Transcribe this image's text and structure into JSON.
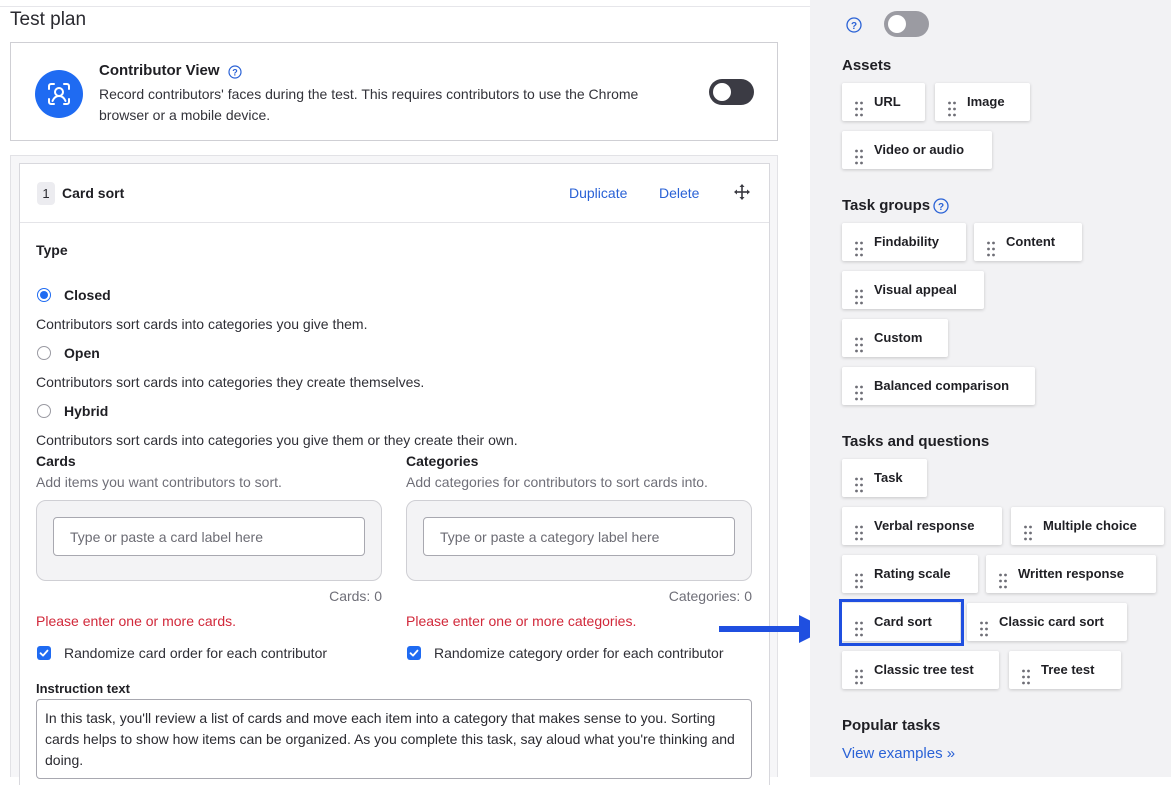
{
  "page": {
    "title": "Test plan"
  },
  "contributor_view": {
    "title": "Contributor View",
    "description": "Record contributors' faces during the test. This requires contributors to use the Chrome browser or a mobile device."
  },
  "task": {
    "number": "1",
    "name": "Card sort",
    "duplicate_label": "Duplicate",
    "delete_label": "Delete",
    "type_label": "Type",
    "options": [
      {
        "label": "Closed",
        "description": "Contributors sort cards into categories you give them."
      },
      {
        "label": "Open",
        "description": "Contributors sort cards into categories they create themselves."
      },
      {
        "label": "Hybrid",
        "description": "Contributors sort cards into categories you give them or they create their own."
      }
    ],
    "cards": {
      "label": "Cards",
      "hint": "Add items you want contributors to sort.",
      "placeholder": "Type or paste a card label here",
      "count": "Cards: 0",
      "error": "Please enter one or more cards.",
      "randomize": "Randomize card order for each contributor"
    },
    "categories": {
      "label": "Categories",
      "hint": "Add categories for contributors to sort cards into.",
      "placeholder": "Type or paste a category label here",
      "count": "Categories: 0",
      "error": "Please enter one or more categories.",
      "randomize": "Randomize category order for each contributor"
    },
    "instruction": {
      "label": "Instruction text",
      "value": "In this task, you'll review a list of cards and move each item into a category that makes sense to you. Sorting cards helps to show how items can be organized. As you complete this task, say aloud what you're thinking and doing."
    }
  },
  "sidebar": {
    "assets": {
      "title": "Assets",
      "items": [
        "URL",
        "Image",
        "Video or audio"
      ]
    },
    "task_groups": {
      "title": "Task groups",
      "items": [
        "Findability",
        "Content",
        "Visual appeal",
        "Custom",
        "Balanced comparison"
      ]
    },
    "tasks_questions": {
      "title": "Tasks and questions",
      "items": [
        "Task",
        "Verbal response",
        "Multiple choice",
        "Rating scale",
        "Written response",
        "Card sort",
        "Classic card sort",
        "Classic tree test",
        "Tree test"
      ]
    },
    "popular": {
      "title": "Popular tasks",
      "link": "View examples »"
    }
  },
  "colors": {
    "accent": "#1f6bf2",
    "link": "#2a62d6",
    "error": "#d1283a",
    "highlight": "#1f4fe0"
  }
}
